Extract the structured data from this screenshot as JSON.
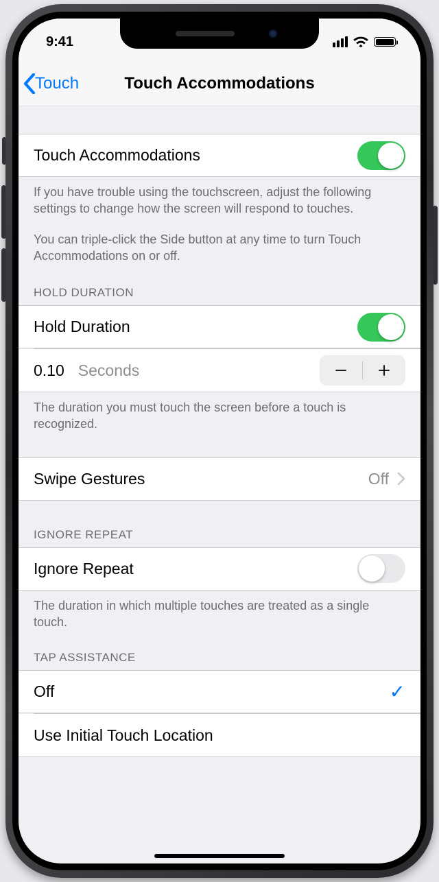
{
  "status": {
    "time": "9:41"
  },
  "nav": {
    "back_label": "Touch",
    "title": "Touch Accommodations"
  },
  "touch_accommodations": {
    "label": "Touch Accommodations",
    "enabled": true,
    "footer1": "If you have trouble using the touchscreen, adjust the following settings to change how the screen will respond to touches.",
    "footer2": "You can triple-click the Side button at any time to turn Touch Accommodations on or off."
  },
  "hold_duration": {
    "header": "HOLD DURATION",
    "label": "Hold Duration",
    "enabled": true,
    "value": "0.10",
    "unit": "Seconds",
    "footer": "The duration you must touch the screen before a touch is recognized."
  },
  "swipe_gestures": {
    "label": "Swipe Gestures",
    "value": "Off"
  },
  "ignore_repeat": {
    "header": "IGNORE REPEAT",
    "label": "Ignore Repeat",
    "enabled": false,
    "footer": "The duration in which multiple touches are treated as a single touch."
  },
  "tap_assistance": {
    "header": "TAP ASSISTANCE",
    "options": [
      {
        "label": "Off",
        "selected": true
      },
      {
        "label": "Use Initial Touch Location",
        "selected": false
      }
    ]
  }
}
